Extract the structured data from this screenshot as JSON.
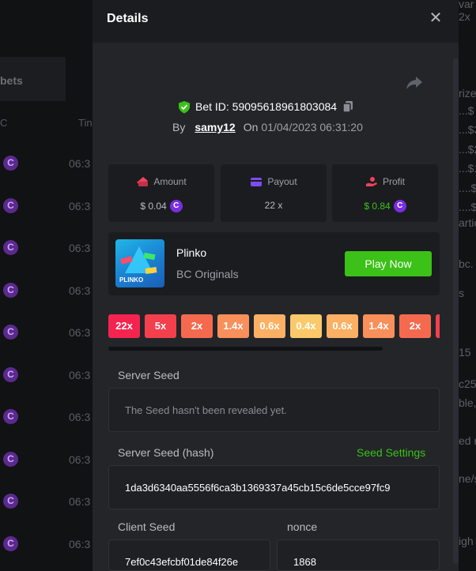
{
  "background": {
    "left_header": "bets",
    "col_a": "C",
    "col_b": "Tin",
    "rows": [
      {
        "time": "06:3"
      },
      {
        "time": "06:3"
      },
      {
        "time": "06:3"
      },
      {
        "time": "06:3"
      },
      {
        "time": "06:3"
      },
      {
        "time": "06:3"
      },
      {
        "time": "06:3"
      },
      {
        "time": "06:3"
      },
      {
        "time": "06:3"
      },
      {
        "time": "06:3"
      }
    ],
    "right_fragments": [
      "var",
      "2x",
      "rize",
      "...$",
      "...$3",
      "...$2",
      "...$1",
      "....$",
      "....$",
      "artic",
      "bc.",
      "s",
      "15",
      "c25",
      "ble,",
      "ed r",
      "ne/s",
      "igh"
    ]
  },
  "modal": {
    "title": "Details",
    "bet_id_label": "Bet ID: 59095618961803084",
    "by_label": "By",
    "username": "samy12",
    "on_label": "On",
    "date": "01/04/2023 06:31:20"
  },
  "stats": {
    "amount": {
      "label": "Amount",
      "value": "$ 0.04"
    },
    "payout": {
      "label": "Payout",
      "value": "22 x"
    },
    "profit": {
      "label": "Profit",
      "value": "$ 0.84"
    }
  },
  "game": {
    "thumb_text": "PLINKO",
    "name": "Plinko",
    "provider": "BC Originals",
    "play_label": "Play Now"
  },
  "multipliers": [
    {
      "label": "22x",
      "color": "#f4244f"
    },
    {
      "label": "5x",
      "color": "#f43f4d"
    },
    {
      "label": "2x",
      "color": "#f56a4f"
    },
    {
      "label": "1.4x",
      "color": "#f98f5a"
    },
    {
      "label": "0.6x",
      "color": "#fbb064"
    },
    {
      "label": "0.4x",
      "color": "#fcc96a"
    },
    {
      "label": "0.6x",
      "color": "#fbb064"
    },
    {
      "label": "1.4x",
      "color": "#f98f5a"
    },
    {
      "label": "2x",
      "color": "#f56a4f"
    },
    {
      "label": "",
      "color": "#f43f4d"
    }
  ],
  "seeds": {
    "server_seed_label": "Server Seed",
    "server_seed_value": "The Seed hasn't been revealed yet.",
    "server_hash_label": "Server Seed (hash)",
    "seed_settings_label": "Seed Settings",
    "server_hash_value": "1da3d6340aa5556f6ca3b1369337a45cb15c6de5cce97fc9",
    "client_seed_label": "Client Seed",
    "client_seed_value": "7ef0c43efcbf01de84f26e",
    "nonce_label": "nonce",
    "nonce_value": "1868"
  },
  "colors": {
    "accent_green": "#3bc117",
    "coin_purple": "#7a2ee0"
  }
}
